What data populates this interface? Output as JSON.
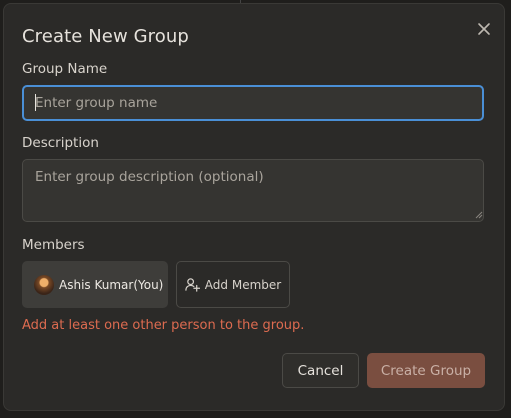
{
  "dialog": {
    "title": "Create New Group",
    "close_icon": "close-icon"
  },
  "group_name": {
    "label": "Group Name",
    "placeholder": "Enter group name",
    "value": ""
  },
  "description": {
    "label": "Description",
    "placeholder": "Enter group description (optional)",
    "value": ""
  },
  "members": {
    "label": "Members",
    "list": [
      {
        "name": "Ashis Kumar(You)",
        "icon": "avatar"
      }
    ],
    "add_button_label": "Add Member",
    "add_button_icon": "user-plus-icon"
  },
  "validation": {
    "error_text": "Add at least one other person to the group.",
    "error_color": "#dd6b50"
  },
  "actions": {
    "cancel_label": "Cancel",
    "create_label": "Create Group",
    "create_disabled": true
  },
  "colors": {
    "focus_ring": "#4a8fd6",
    "primary_button": "#7a4e40"
  }
}
